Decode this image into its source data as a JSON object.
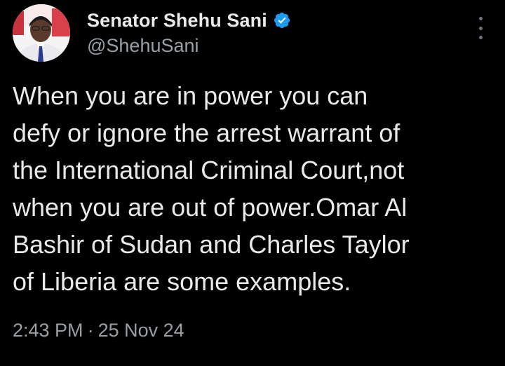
{
  "tweet": {
    "author": {
      "display_name": "Senator Shehu Sani",
      "handle": "@ShehuSani",
      "verified": true,
      "avatar_icon": "avatar-portrait"
    },
    "more_icon": "more-vertical-icon",
    "text_lines": [
      "When you are in power you can",
      "defy or ignore the arrest warrant of",
      "the International Criminal Court,not",
      "when you are out of power.Omar Al",
      "Bashir of Sudan and Charles Taylor",
      "of Liberia are some examples."
    ],
    "time": "2:43 PM",
    "separator": "·",
    "date": "25 Nov 24"
  },
  "colors": {
    "background": "#000000",
    "primary_text": "#e7e9ea",
    "secondary_text": "#9a9fa4",
    "verified_badge": "#1d9bf0"
  }
}
